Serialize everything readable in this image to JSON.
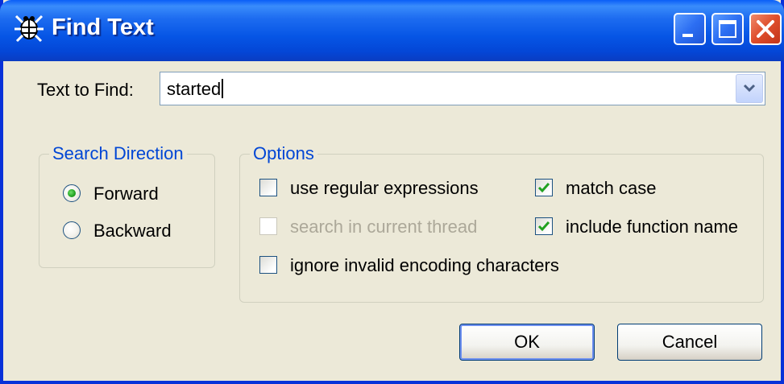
{
  "window": {
    "title": "Find Text",
    "controls": [
      "minimize-icon",
      "maximize-icon",
      "close-icon"
    ]
  },
  "find": {
    "label": "Text to Find:",
    "value": "started"
  },
  "search_direction": {
    "legend": "Search Direction",
    "options": [
      {
        "label": "Forward",
        "selected": true
      },
      {
        "label": "Backward",
        "selected": false
      }
    ]
  },
  "options": {
    "legend": "Options",
    "items": [
      {
        "label": "use regular expressions",
        "checked": false,
        "enabled": true
      },
      {
        "label": "search in current thread",
        "checked": false,
        "enabled": false
      },
      {
        "label": "ignore invalid encoding characters",
        "checked": false,
        "enabled": true
      },
      {
        "label": "match case",
        "checked": true,
        "enabled": true
      },
      {
        "label": "include function name",
        "checked": true,
        "enabled": true
      }
    ]
  },
  "buttons": {
    "ok": "OK",
    "cancel": "Cancel"
  },
  "colors": {
    "title_bar": "#0655e5",
    "dialog_bg": "#ece9d8",
    "group_legend": "#0046d5",
    "disabled_text": "#aca899",
    "check_mark": "#21a121"
  }
}
